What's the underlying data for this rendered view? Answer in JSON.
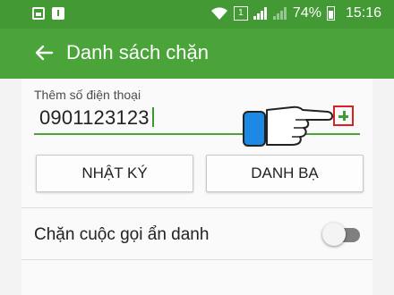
{
  "status_bar": {
    "battery": "74%",
    "time": "15:16",
    "sim_label": "1",
    "icons": [
      "image-icon",
      "calendar-icon",
      "wifi-icon",
      "signal-icon",
      "battery-icon"
    ]
  },
  "app_bar": {
    "title": "Danh sách chặn",
    "back_icon": "arrow-left-icon"
  },
  "add_number": {
    "label": "Thêm số điện thoại",
    "value": "0901123123",
    "add_icon": "plus-icon"
  },
  "buttons": {
    "log": "NHẬT KÝ",
    "contacts": "DANH BẠ"
  },
  "anonymous_block": {
    "label": "Chặn cuộc gọi ẩn danh",
    "enabled": false
  },
  "colors": {
    "status_bar": "#439a35",
    "app_bar": "#4aa43a",
    "accent": "#4aa43a",
    "highlight_box": "#d62222",
    "hand_cuff": "#1e88e5"
  }
}
